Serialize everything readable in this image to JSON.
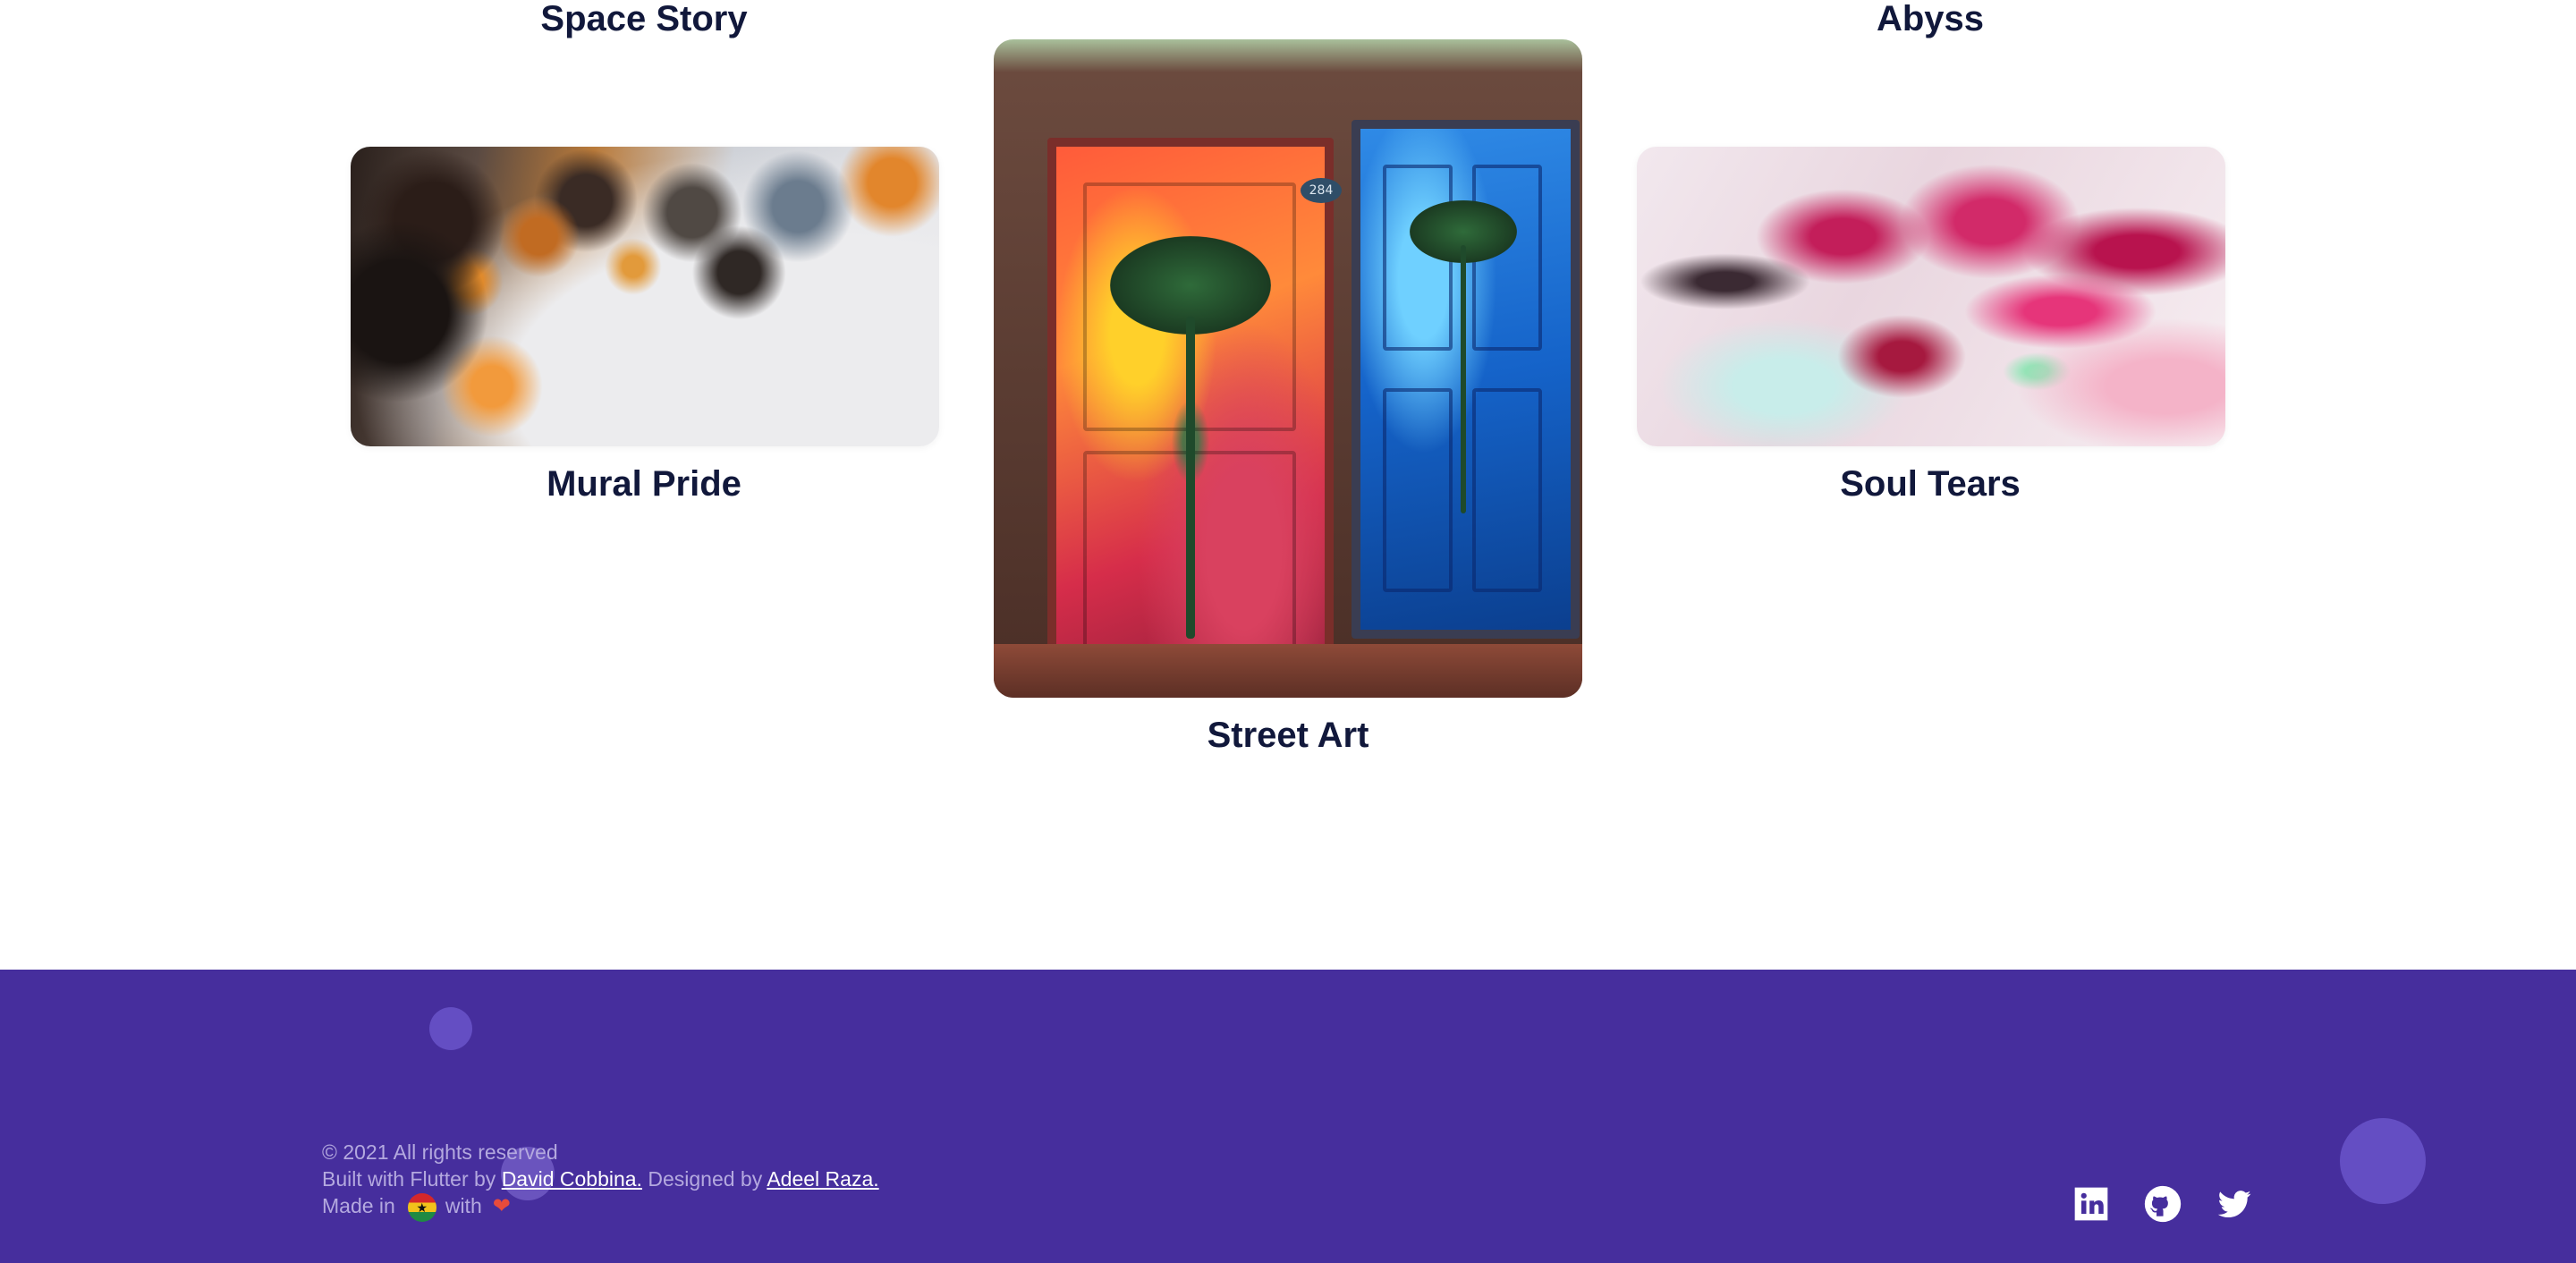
{
  "gallery": {
    "space_story_title": "Space Story",
    "abyss_title": "Abyss",
    "mural_title": "Mural Pride",
    "street_title": "Street Art",
    "soul_title": "Soul Tears",
    "door_number": "284"
  },
  "footer": {
    "copyright": "© 2021 All rights reserved",
    "built_prefix": "Built with Flutter by ",
    "developer_name": "David Cobbina.",
    "designed_prefix": " Designed by ",
    "designer_name": "Adeel Raza.",
    "made_in": "Made in",
    "with": "with",
    "heart": "❤"
  },
  "social": [
    "linkedin-icon",
    "github-icon",
    "twitter-icon"
  ],
  "colors": {
    "footer_bg": "#462e9d",
    "title_text": "#11183b",
    "footer_text": "#b4a9df",
    "link_text": "#ffffff"
  }
}
